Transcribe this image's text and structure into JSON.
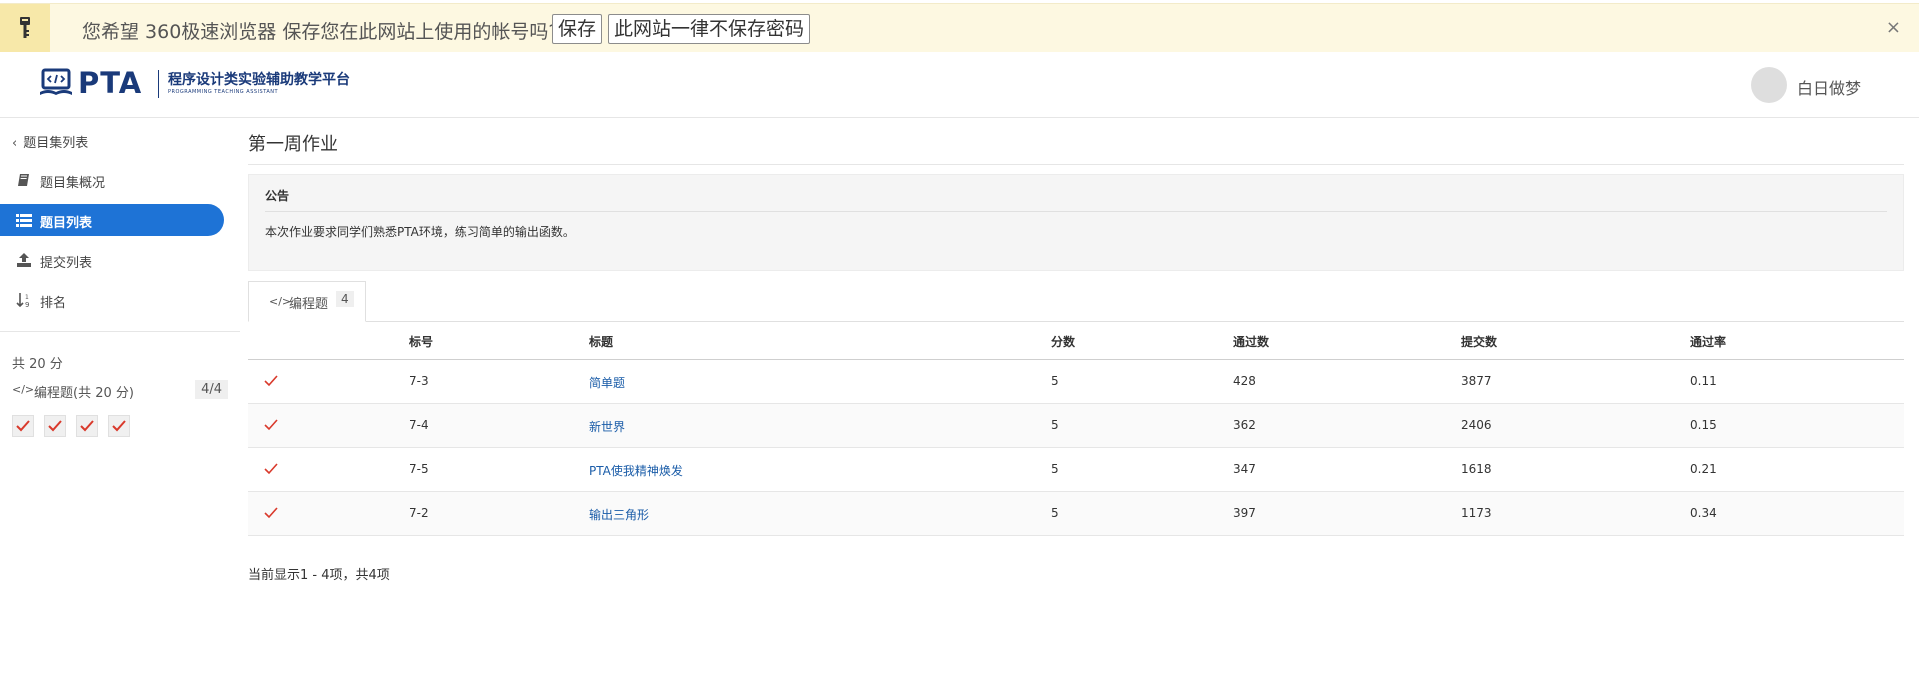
{
  "password_bar": {
    "message": "您希望 360极速浏览器 保存您在此网站上使用的帐号吗?",
    "save_label": "保存",
    "never_label": "此网站一律不保存密码",
    "close_label": "×"
  },
  "header": {
    "logo_text": "PTA",
    "logo_cn": "程序设计类实验辅助教学平台",
    "logo_en": "PROGRAMMING TEACHING ASSISTANT",
    "username": "白日做梦"
  },
  "sidebar": {
    "back_label": "题目集列表",
    "items": [
      {
        "label": "题目集概况",
        "icon": "book-icon"
      },
      {
        "label": "题目列表",
        "icon": "list-icon"
      },
      {
        "label": "提交列表",
        "icon": "upload-icon"
      },
      {
        "label": "排名",
        "icon": "sort-icon"
      }
    ],
    "total_label": "共 20 分",
    "section": {
      "label": "编程题(共 20 分)",
      "count": "4/4"
    }
  },
  "main": {
    "title": "第一周作业",
    "notice": {
      "title": "公告",
      "body": "本次作业要求同学们熟悉PTA环境，练习简单的输出函数。"
    },
    "tab": {
      "label": "编程题",
      "count": "4"
    },
    "columns": [
      "",
      "标号",
      "标题",
      "分数",
      "通过数",
      "提交数",
      "通过率"
    ],
    "rows": [
      {
        "id": "7-3",
        "title": "简单题",
        "score": "5",
        "passed": "428",
        "submitted": "3877",
        "rate": "0.11"
      },
      {
        "id": "7-4",
        "title": "新世界",
        "score": "5",
        "passed": "362",
        "submitted": "2406",
        "rate": "0.15"
      },
      {
        "id": "7-5",
        "title": "PTA使我精神焕发",
        "score": "5",
        "passed": "347",
        "submitted": "1618",
        "rate": "0.21"
      },
      {
        "id": "7-2",
        "title": "输出三角形",
        "score": "5",
        "passed": "397",
        "submitted": "1173",
        "rate": "0.34"
      }
    ],
    "footer": "当前显示1 - 4项，共4项"
  },
  "colors": {
    "accent": "#1e73d6",
    "check": "#d9392b",
    "link": "#1a5ca8",
    "brand": "#1a3a7a"
  }
}
